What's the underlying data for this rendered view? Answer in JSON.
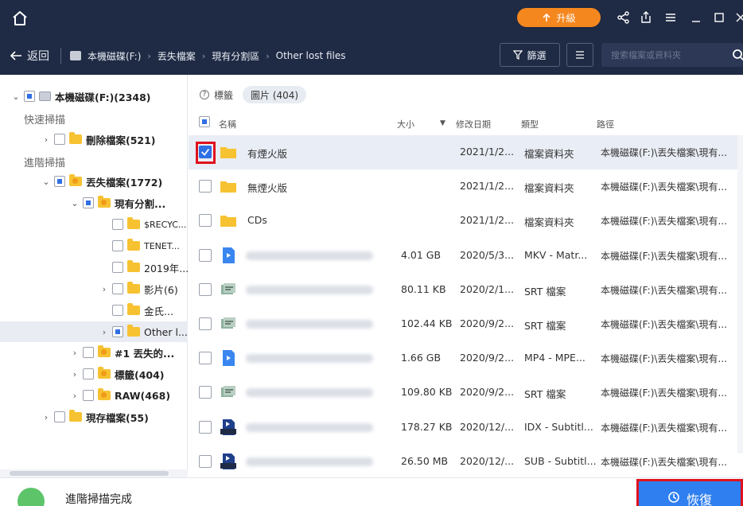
{
  "colors": {
    "titlebar": "#1f2a44",
    "accent": "#2f7ff0",
    "upgrade": "#f5871f",
    "highlight": "#e0121d"
  },
  "titlebar": {
    "icons": [
      "home-icon",
      "share-icon",
      "export-icon",
      "menu-icon",
      "minimize-icon",
      "maximize-icon",
      "close-icon"
    ],
    "upgrade_label": "升級"
  },
  "nav": {
    "back_label": "返回",
    "breadcrumb": [
      "本機磁碟(F:)",
      "丟失檔案",
      "現有分割區",
      "Other lost files"
    ],
    "filter_label": "篩選",
    "search_placeholder": "搜索檔案或資料夾"
  },
  "tree": {
    "root": "本機磁碟(F:)(2348)",
    "quick_scan": "快速掃描",
    "deleted": "刪除檔案(521)",
    "advanced_scan": "進階掃描",
    "lost": "丟失檔案(1772)",
    "existing_partition": "現有分割...",
    "children": [
      "$RECYC...",
      "TENET...",
      "2019年...",
      "影片(6)",
      "金氏...",
      "Other l..."
    ],
    "lost_partition": "#1 丟失的...",
    "tags": "標籤(404)",
    "raw": "RAW(468)",
    "existing_files": "現存檔案(55)"
  },
  "tagbar": {
    "label": "標籤",
    "chip": "圖片 (404)"
  },
  "columns": {
    "name": "名稱",
    "size": "大小",
    "date": "修改日期",
    "type": "類型",
    "path": "路徑"
  },
  "files": [
    {
      "name": "有煙火版",
      "size": "",
      "date": "2021/1/2...",
      "type": "檔案資料夾",
      "path": "本機磁碟(F:)\\丟失檔案\\現有...",
      "icon": "folder-icon",
      "checked": true
    },
    {
      "name": "無煙火版",
      "size": "",
      "date": "2021/1/2...",
      "type": "檔案資料夾",
      "path": "本機磁碟(F:)\\丟失檔案\\現有...",
      "icon": "folder-icon",
      "checked": false
    },
    {
      "name": "CDs",
      "size": "",
      "date": "2021/1/2...",
      "type": "檔案資料夾",
      "path": "本機磁碟(F:)\\丟失檔案\\現有...",
      "icon": "folder-icon",
      "checked": false
    },
    {
      "name": "",
      "size": "4.01 GB",
      "date": "2020/5/3...",
      "type": "MKV - Matr...",
      "path": "本機磁碟(F:)\\丟失檔案\\現有...",
      "icon": "video-file-icon",
      "checked": false
    },
    {
      "name": "",
      "size": "80.11 KB",
      "date": "2020/2/1...",
      "type": "SRT 檔案",
      "path": "本機磁碟(F:)\\丟失檔案\\現有...",
      "icon": "subtitle-file-icon",
      "checked": false
    },
    {
      "name": "",
      "size": "102.44 KB",
      "date": "2020/9/2...",
      "type": "SRT 檔案",
      "path": "本機磁碟(F:)\\丟失檔案\\現有...",
      "icon": "subtitle-file-icon",
      "checked": false
    },
    {
      "name": "",
      "size": "1.66 GB",
      "date": "2020/9/2...",
      "type": "MP4 - MPE...",
      "path": "本機磁碟(F:)\\丟失檔案\\現有...",
      "icon": "video-file-icon",
      "checked": false
    },
    {
      "name": "",
      "size": "109.80 KB",
      "date": "2020/9/2...",
      "type": "SRT 檔案",
      "path": "本機磁碟(F:)\\丟失檔案\\現有...",
      "icon": "subtitle-file-icon",
      "checked": false
    },
    {
      "name": "",
      "size": "178.27 KB",
      "date": "2020/12/...",
      "type": "IDX - Subtitl...",
      "path": "本機磁碟(F:)\\丟失檔案\\現有...",
      "icon": "idx-file-icon",
      "checked": false
    },
    {
      "name": "",
      "size": "26.50 MB",
      "date": "2020/12/...",
      "type": "SUB - Subtitl...",
      "path": "本機磁碟(F:)\\丟失檔案\\現有...",
      "icon": "sub-file-icon",
      "checked": false
    }
  ],
  "status": {
    "text": "進階掃描完成"
  },
  "recover_label": "恢復"
}
